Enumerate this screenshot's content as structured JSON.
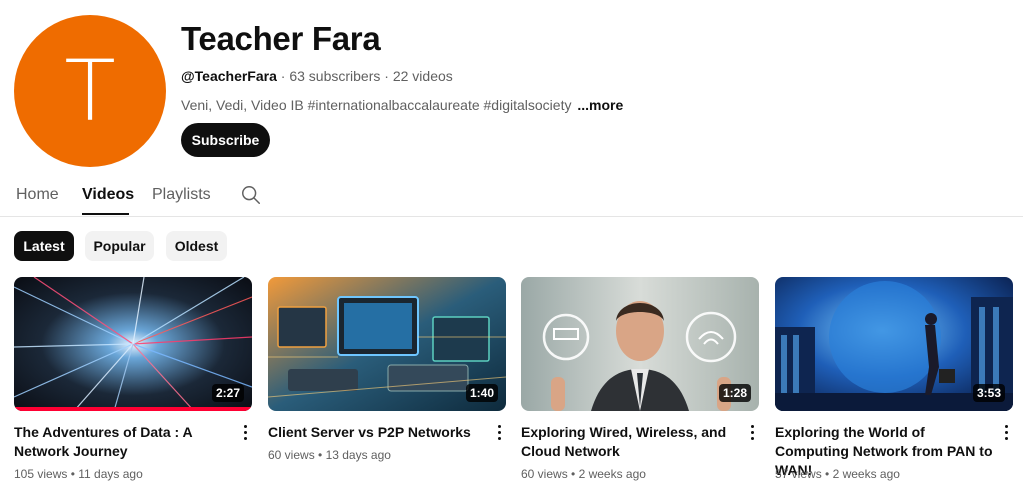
{
  "channel": {
    "avatar_letter": "T",
    "avatar_color": "#ef6c00",
    "name": "Teacher Fara",
    "handle": "@TeacherFara",
    "subscribers": "63 subscribers",
    "videos_count": "22 videos",
    "separator": " · ",
    "description": "Veni, Vedi, Video IB #internationalbaccalaureate  #digitalsociety",
    "more_label": "...more",
    "subscribe_label": "Subscribe"
  },
  "tabs": [
    {
      "label": "Home",
      "active": false
    },
    {
      "label": "Videos",
      "active": true
    },
    {
      "label": "Playlists",
      "active": false
    }
  ],
  "search_icon": "search-icon",
  "filters": [
    {
      "label": "Latest",
      "active": true
    },
    {
      "label": "Popular",
      "active": false
    },
    {
      "label": "Oldest",
      "active": false
    }
  ],
  "videos": [
    {
      "title": "The Adventures of Data : A Network Journey",
      "duration": "2:27",
      "views": "105 views",
      "age": "11 days ago",
      "watched": true
    },
    {
      "title": "Client Server vs P2P Networks",
      "duration": "1:40",
      "views": "60 views",
      "age": "13 days ago",
      "watched": false
    },
    {
      "title": "Exploring Wired, Wireless, and Cloud Network",
      "duration": "1:28",
      "views": "60 views",
      "age": "2 weeks ago",
      "watched": false
    },
    {
      "title": "Exploring the World of Computing Network from PAN to WAN!",
      "duration": "3:53",
      "views": "57 views",
      "age": "2 weeks ago",
      "watched": false
    }
  ],
  "stats_separator": " • "
}
